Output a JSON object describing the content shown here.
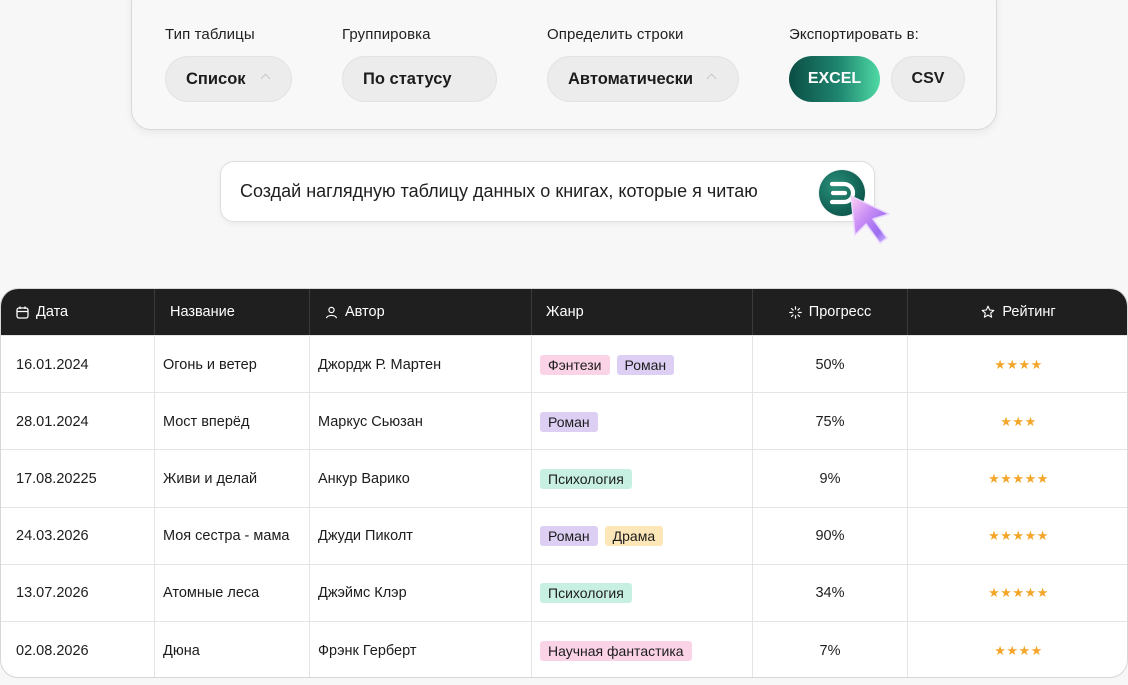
{
  "options": {
    "table_type": {
      "label": "Тип таблицы",
      "value": "Список"
    },
    "grouping": {
      "label": "Группировка",
      "value": "По статусу"
    },
    "rows": {
      "label": "Определить строки",
      "value": "Автоматически"
    },
    "export": {
      "label": "Экспортировать в:",
      "excel": "EXCEL",
      "csv": "CSV"
    }
  },
  "prompt": {
    "text": "Создай наглядную таблицу данных о книгах, которые я читаю",
    "send_icon": "send-logo-icon"
  },
  "colors": {
    "accent_dark": "#0b4d44",
    "accent_light": "#4fd9a4",
    "header_bg": "#1f1f1f",
    "star": "#f4a62a",
    "tag_fantasy": "#fbd3e6",
    "tag_novel": "#dccff3",
    "tag_psychology": "#c8f0e2",
    "tag_drama": "#fde7b8",
    "tag_scifi": "#fbd3e6"
  },
  "table": {
    "columns": [
      {
        "label": "Дата",
        "icon": "calendar-icon"
      },
      {
        "label": "Название",
        "icon": ""
      },
      {
        "label": "Автор",
        "icon": "user-icon"
      },
      {
        "label": "Жанр",
        "icon": ""
      },
      {
        "label": "Прогресс",
        "icon": "loader-icon"
      },
      {
        "label": "Рейтинг",
        "icon": "star-outline-icon"
      }
    ],
    "rows": [
      {
        "date": "16.01.2024",
        "title": "Огонь и ветер",
        "author": "Джордж Р. Мартен",
        "genres": [
          {
            "name": "Фэнтези",
            "color": "#fbd3e6"
          },
          {
            "name": "Роман",
            "color": "#dccff3"
          }
        ],
        "progress": "50%",
        "rating": 4
      },
      {
        "date": "28.01.2024",
        "title": "Мост вперёд",
        "author": "Маркус Сьюзан",
        "genres": [
          {
            "name": "Роман",
            "color": "#dccff3"
          }
        ],
        "progress": "75%",
        "rating": 3
      },
      {
        "date": "17.08.20225",
        "title": "Живи и делай",
        "author": "Анкур Варико",
        "genres": [
          {
            "name": "Психология",
            "color": "#c8f0e2"
          }
        ],
        "progress": "9%",
        "rating": 5
      },
      {
        "date": "24.03.2026",
        "title": "Моя сестра - мама",
        "author": "Джуди Пиколт",
        "genres": [
          {
            "name": "Роман",
            "color": "#dccff3"
          },
          {
            "name": "Драма",
            "color": "#fde7b8"
          }
        ],
        "progress": "90%",
        "rating": 5
      },
      {
        "date": "13.07.2026",
        "title": "Атомные леса",
        "author": "Джэймс Клэр",
        "genres": [
          {
            "name": "Психология",
            "color": "#c8f0e2"
          }
        ],
        "progress": "34%",
        "rating": 5
      },
      {
        "date": "02.08.2026",
        "title": "Дюна",
        "author": "Фрэнк Герберт",
        "genres": [
          {
            "name": "Научная фантастика",
            "color": "#fbd3e6"
          }
        ],
        "progress": "7%",
        "rating": 4
      }
    ]
  }
}
